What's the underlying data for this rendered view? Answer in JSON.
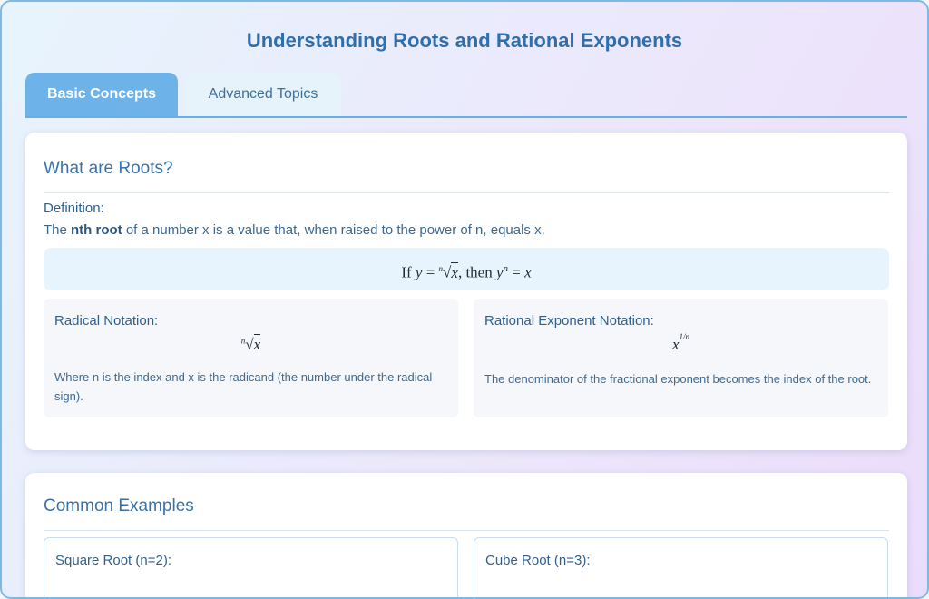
{
  "page": {
    "title": "Understanding Roots and Rational Exponents"
  },
  "tabs": [
    {
      "label": "Basic Concepts",
      "active": true
    },
    {
      "label": "Advanced Topics",
      "active": false
    }
  ],
  "roots_card": {
    "heading": "What are Roots?",
    "definition_label": "Definition:",
    "definition_pre": "The ",
    "definition_bold": "nth root",
    "definition_post": " of a number x is a value that, when raised to the power of n, equals x.",
    "formula": {
      "if_word": "If",
      "then_word": "then"
    },
    "radical": {
      "label": "Radical Notation:",
      "description": "Where n is the index and x is the radicand (the number under the radical sign)."
    },
    "rational": {
      "label": "Rational Exponent Notation:",
      "description": "The denominator of the fractional exponent becomes the index of the root."
    }
  },
  "examples_card": {
    "heading": "Common Examples",
    "items": [
      {
        "label": "Square Root (n=2):"
      },
      {
        "label": "Cube Root (n=3):"
      }
    ]
  },
  "colors": {
    "accent": "#2f6fae",
    "tab_active_bg": "#6db3e9",
    "formula_bg": "#e8f4fd"
  }
}
